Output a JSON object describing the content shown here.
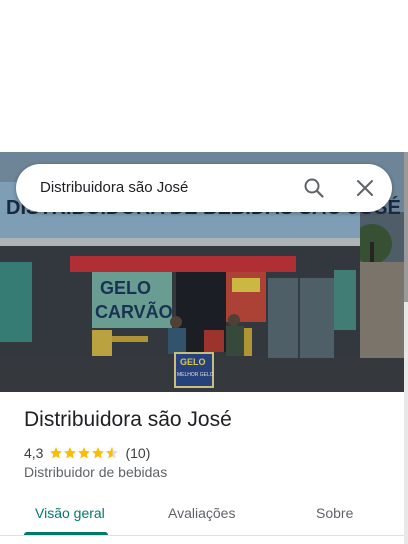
{
  "search": {
    "value": "Distribuidora são José",
    "search_icon": "search-icon",
    "close_icon": "close-icon"
  },
  "place": {
    "name": "Distribuidora são José",
    "rating": "4,3",
    "stars": 4.3,
    "reviews": "(10)",
    "category": "Distribuidor de bebidas"
  },
  "photo": {
    "storefront_sign": "DISTRIBUIDORA DE BEBIDAS SÃO JOSÉ",
    "wall_text_1": "GELO",
    "wall_text_2": "CARVÃO",
    "small_sign_title": "GELO",
    "small_sign_sub": "MELHOR GELO"
  },
  "tabs": [
    {
      "label": "Visão geral",
      "active": true
    },
    {
      "label": "Avaliações",
      "active": false
    },
    {
      "label": "Sobre",
      "active": false
    }
  ],
  "colors": {
    "accent": "#00796b",
    "star": "#fbbc04"
  }
}
